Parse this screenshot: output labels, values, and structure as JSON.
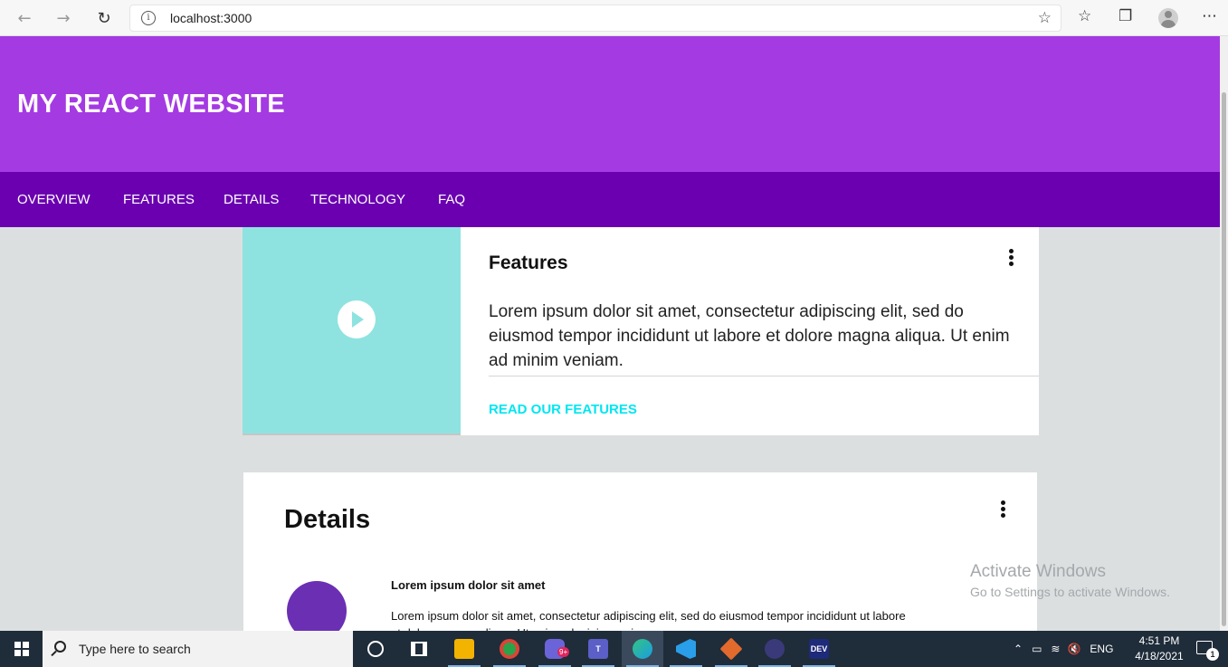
{
  "browser": {
    "url": "localhost:3000",
    "back_icon": "arrow-left-icon",
    "forward_icon": "arrow-right-icon",
    "refresh_icon": "refresh-icon",
    "info_icon": "info-icon",
    "favorite_icon": "star-plus-icon",
    "favorites_icon": "star-list-icon",
    "collections_icon": "collections-icon",
    "profile_icon": "profile-icon",
    "menu_icon": "more-icon"
  },
  "site": {
    "title": "MY REACT WEBSITE",
    "nav": [
      "OVERVIEW",
      "FEATURES",
      "DETAILS",
      "TECHNOLOGY",
      "FAQ"
    ],
    "colors": {
      "header": "#a43ae2",
      "nav": "#6a00b0",
      "media": "#8ee3e0",
      "link": "#00e6f0",
      "avatar": "#6b2fb3"
    }
  },
  "features_card": {
    "title": "Features",
    "text": "Lorem ipsum dolor sit amet, consectetur adipiscing elit, sed do eiusmod tempor incididunt ut labore et dolore magna aliqua. Ut enim ad minim veniam.",
    "link": "READ OUR FEATURES"
  },
  "details_card": {
    "title": "Details",
    "item_heading": "Lorem ipsum dolor sit amet",
    "item_text": "Lorem ipsum dolor sit amet, consectetur adipiscing elit, sed do eiusmod tempor incididunt ut labore et dolore magna aliqua. Ut enim ad minim veniam."
  },
  "watermark": {
    "title": "Activate Windows",
    "subtitle": "Go to Settings to activate Windows."
  },
  "taskbar": {
    "search_placeholder": "Type here to search",
    "apps": [
      {
        "name": "cortana-icon"
      },
      {
        "name": "task-view-icon"
      },
      {
        "name": "file-explorer-icon",
        "color": "#f2b400"
      },
      {
        "name": "chrome-icon",
        "color": "#2aa34a"
      },
      {
        "name": "discord-icon",
        "color": "#6a64d8",
        "badge": "9+"
      },
      {
        "name": "teams-icon",
        "color": "#5b5fc7"
      },
      {
        "name": "edge-icon",
        "color": "#1b9de2"
      },
      {
        "name": "vscode-icon",
        "color": "#2a9ee8"
      },
      {
        "name": "git-icon",
        "color": "#e26a2c"
      },
      {
        "name": "github-icon",
        "color": "#3a3a7a"
      },
      {
        "name": "devtools-icon",
        "color": "#1e2a7a",
        "label": "DEV"
      }
    ],
    "language": "ENG",
    "time": "4:51 PM",
    "date": "4/18/2021",
    "notification_count": "1"
  }
}
